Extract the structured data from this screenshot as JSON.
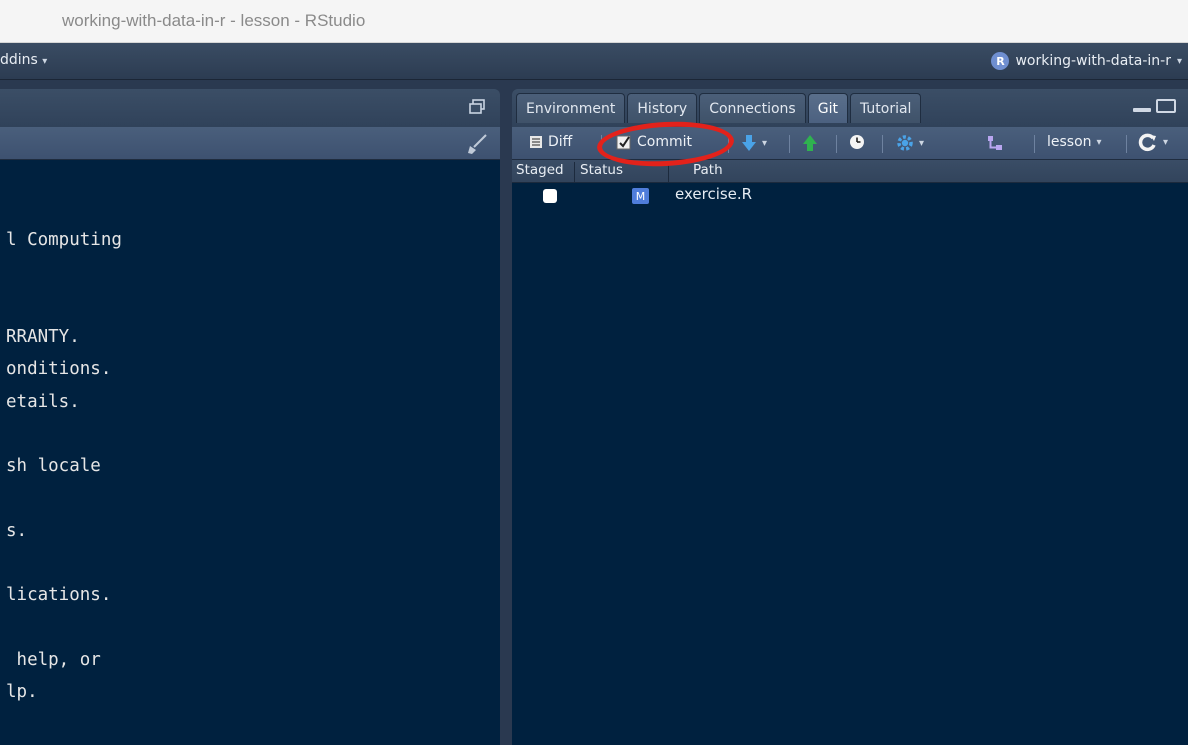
{
  "window": {
    "title": "working-with-data-in-r - lesson - RStudio"
  },
  "main_toolbar": {
    "addins_label": "ddins",
    "project_badge": "R",
    "project_name": "working-with-data-in-r"
  },
  "console": {
    "lines": [
      "l Computing",
      "RRANTY.",
      "onditions.",
      "etails.",
      "sh locale",
      "s.",
      "lications.",
      " help, or",
      "lp."
    ]
  },
  "right_pane": {
    "tabs": [
      "Environment",
      "History",
      "Connections",
      "Git",
      "Tutorial"
    ],
    "active_tab": "Git"
  },
  "git_toolbar": {
    "diff_label": "Diff",
    "commit_label": "Commit",
    "branch": "lesson"
  },
  "git_columns": {
    "staged": "Staged",
    "status": "Status",
    "path": "Path"
  },
  "git_files": [
    {
      "staged": false,
      "status": "M",
      "path": "exercise.R"
    }
  ],
  "colors": {
    "console_bg": "#00213f",
    "toolbar": "#3d5170",
    "annotation_circle": "#e3221b",
    "status_modified": "#4f7ddb"
  },
  "icons": {
    "diff": "diff-icon",
    "commit": "commit-icon",
    "pull": "pull-arrow-icon",
    "push": "push-arrow-icon",
    "history": "clock-icon",
    "settings": "gear-icon",
    "branch": "branch-icon",
    "refresh": "refresh-icon",
    "broom": "broom-icon",
    "popout": "popout-icon"
  }
}
